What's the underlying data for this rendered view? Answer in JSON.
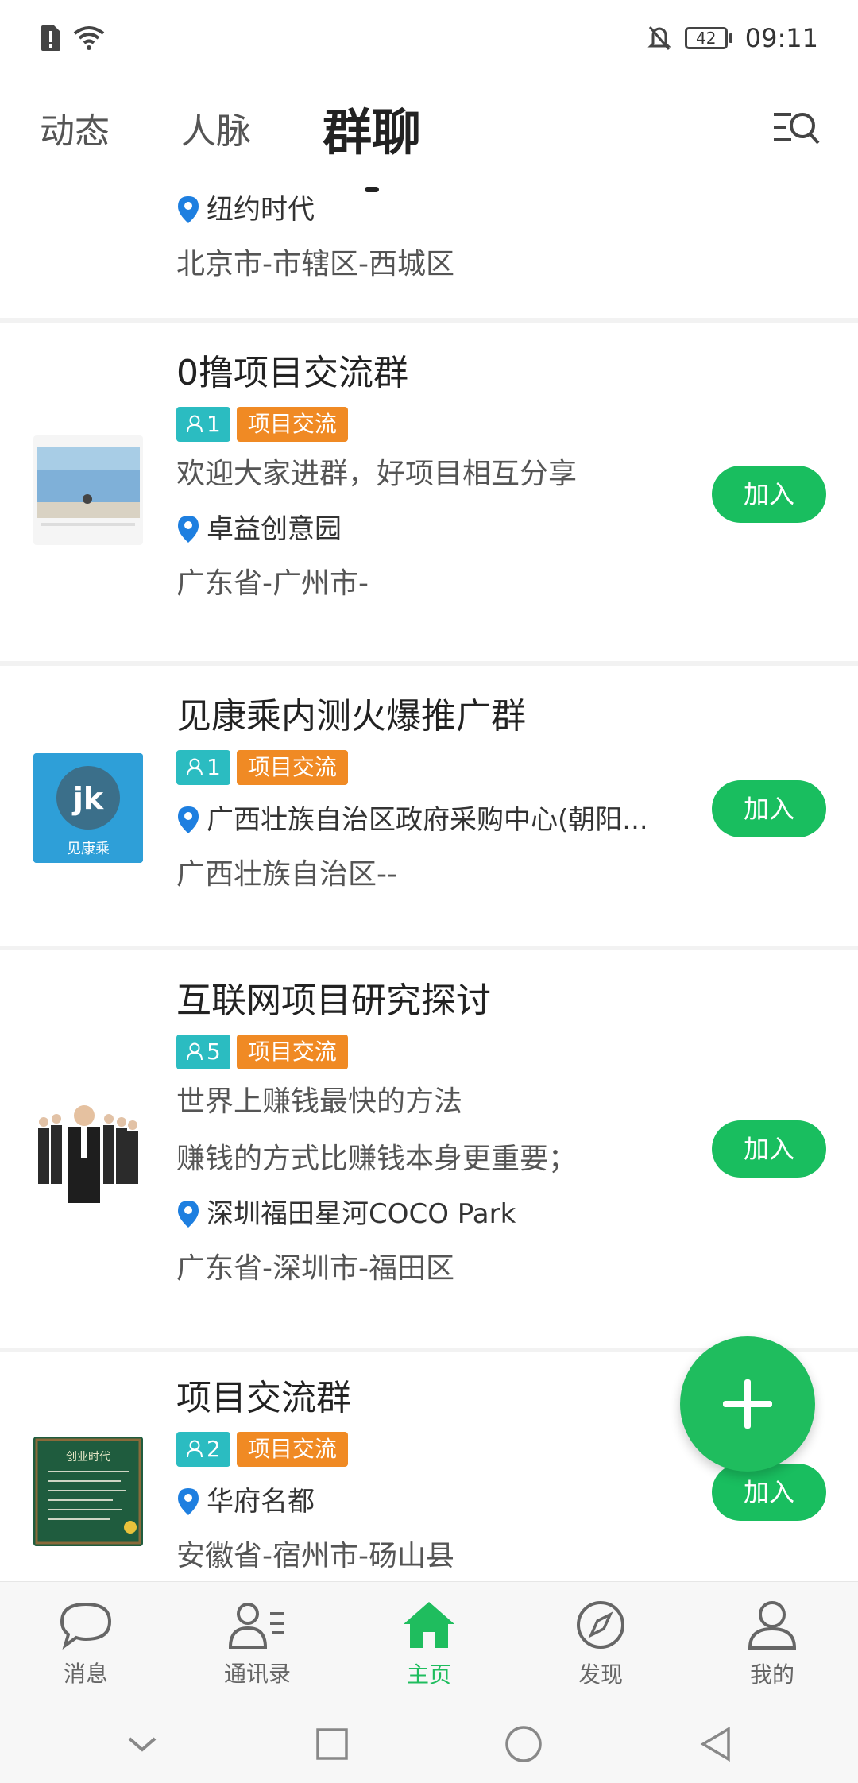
{
  "status_bar": {
    "time": "09:11",
    "battery": "42"
  },
  "tabs": [
    {
      "label": "动态"
    },
    {
      "label": "人脉"
    },
    {
      "label": "群聊"
    }
  ],
  "partial_card": {
    "location": "纽约时代",
    "region": "北京市-市辖区-西城区"
  },
  "groups": [
    {
      "name": "0撸项目交流群",
      "members": "1",
      "type": "项目交流",
      "desc": [
        "欢迎大家进群，好项目相互分享"
      ],
      "location": "卓益创意园",
      "region": "广东省-广州市-",
      "join_label": "加入"
    },
    {
      "name": "见康乘内测火爆推广群",
      "members": "1",
      "type": "项目交流",
      "desc": [],
      "location": "广西壮族自治区政府采购中心(朝阳...",
      "region": "广西壮族自治区--",
      "join_label": "加入",
      "thumb_text": "见康乘",
      "thumb_logo": "jk"
    },
    {
      "name": "互联网项目研究探讨",
      "members": "5",
      "type": "项目交流",
      "desc": [
        "世界上赚钱最快的方法",
        "赚钱的方式比赚钱本身更重要；"
      ],
      "location": "深圳福田星河COCO Park",
      "region": "广东省-深圳市-福田区",
      "join_label": "加入"
    },
    {
      "name": "项目交流群",
      "members": "2",
      "type": "项目交流",
      "desc": [],
      "location": "华府名都",
      "region": "安徽省-宿州市-砀山县",
      "join_label": "加入",
      "thumb_text": "创业时代"
    }
  ],
  "bottom_nav": [
    {
      "label": "消息",
      "icon": "chat-bubble-icon"
    },
    {
      "label": "通讯录",
      "icon": "contacts-icon"
    },
    {
      "label": "主页",
      "icon": "home-icon"
    },
    {
      "label": "发现",
      "icon": "compass-icon"
    },
    {
      "label": "我的",
      "icon": "person-icon"
    }
  ],
  "colors": {
    "accent": "#1fbd5e",
    "tag_members": "#2bbcc1",
    "tag_type": "#f08a24",
    "pin": "#1e7fe0"
  }
}
